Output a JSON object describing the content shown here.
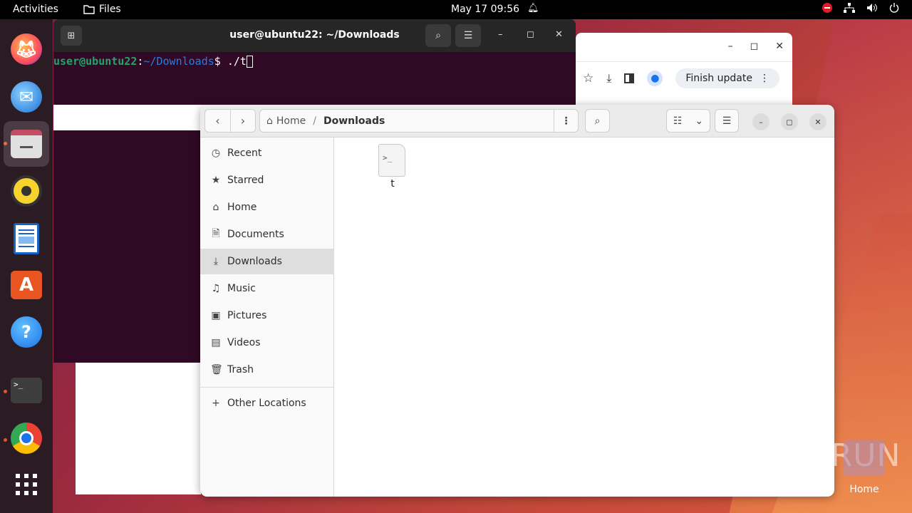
{
  "topbar": {
    "activities": "Activities",
    "app_name": "Files",
    "clock": "May 17  09:56"
  },
  "dock": {
    "items": [
      "firefox",
      "thunderbird",
      "files",
      "rhythmbox",
      "libreoffice-writer",
      "app-center",
      "help",
      "terminal",
      "chrome",
      "show-apps"
    ]
  },
  "chrome": {
    "finish_update": "Finish update"
  },
  "terminal": {
    "title": "user@ubuntu22: ~/Downloads",
    "prompt_user": "user@ubuntu22",
    "prompt_colon": ":",
    "prompt_path": "~/Downloads",
    "prompt_symbol": "$ ",
    "command": "./t"
  },
  "files": {
    "path_home": "Home",
    "path_current": "Downloads",
    "sidebar": [
      {
        "label": "Recent",
        "icon": "clock-icon"
      },
      {
        "label": "Starred",
        "icon": "star-icon"
      },
      {
        "label": "Home",
        "icon": "home-icon"
      },
      {
        "label": "Documents",
        "icon": "document-icon"
      },
      {
        "label": "Downloads",
        "icon": "download-icon"
      },
      {
        "label": "Music",
        "icon": "music-icon"
      },
      {
        "label": "Pictures",
        "icon": "picture-icon"
      },
      {
        "label": "Videos",
        "icon": "video-icon"
      },
      {
        "label": "Trash",
        "icon": "trash-icon"
      }
    ],
    "other_locations": "Other Locations",
    "file": {
      "name": "t",
      "glyph": ">_"
    }
  },
  "desktop": {
    "watermark": "ANY▷RUN",
    "home_label": "Home"
  },
  "colors": {
    "ubuntu_orange": "#e95420",
    "terminal_bg": "#300a24",
    "prompt_user": "#26a269",
    "prompt_path": "#2a7bde"
  }
}
